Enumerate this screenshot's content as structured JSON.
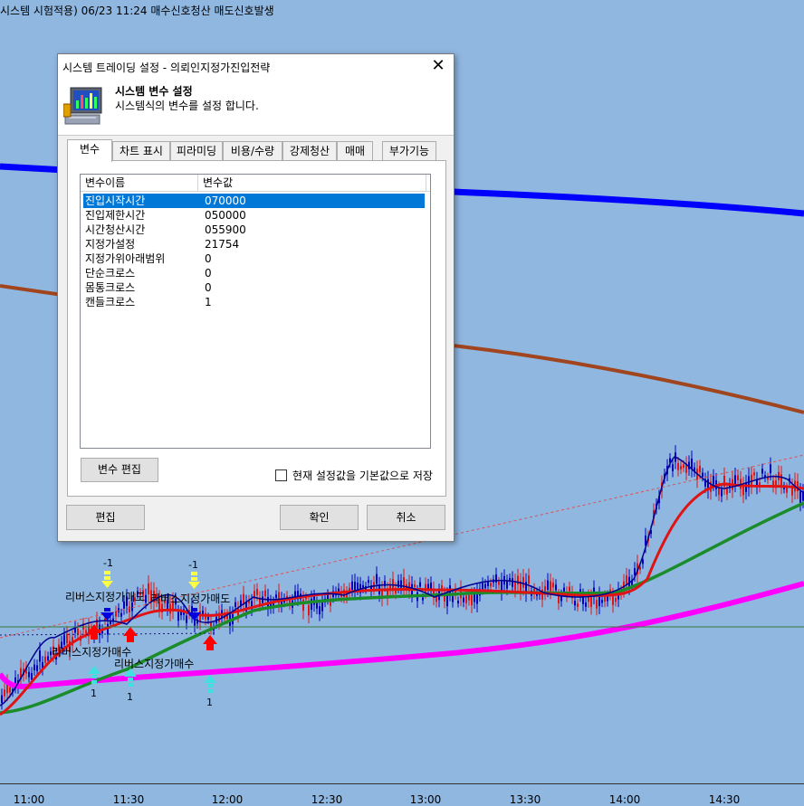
{
  "chart": {
    "title": "시스템 시험적용) 06/23 11:24 매수신호청산 매도신호발생",
    "time_labels": [
      "11:00",
      "11:30",
      "12:00",
      "12:30",
      "13:00",
      "13:30",
      "14:00",
      "14:30"
    ],
    "signals": [
      {
        "kind": "sell",
        "label": "리버스지정가매도",
        "qty": "-1"
      },
      {
        "kind": "sell",
        "label": "리버스지정가매도",
        "qty": "-1"
      },
      {
        "kind": "buy",
        "label": "리버스지정가매수",
        "qty": "1"
      },
      {
        "kind": "buy",
        "label": "리버스지정가매수",
        "qty": "1"
      },
      {
        "kind": "buy",
        "label": "리버스지정가매수",
        "qty": "1"
      }
    ],
    "colors": {
      "background": "#8fb7e0",
      "ma_blue": "#0000ff",
      "ma_brown": "#a0451e",
      "ma_magenta": "#ff00ff",
      "ma_green": "#1a8c2a",
      "ma_red": "#e01414",
      "ma_navy": "#000090"
    }
  },
  "dialog": {
    "title": "시스템 트레이딩 설정 - 의뢰인지정가진입전략",
    "header_title": "시스템 변수 설정",
    "header_sub": "시스템식의 변수를 설정 합니다.",
    "icon": "monitor-chart-icon",
    "tabs": [
      {
        "label": "변수",
        "active": true
      },
      {
        "label": "차트 표시",
        "active": false
      },
      {
        "label": "피라미딩",
        "active": false
      },
      {
        "label": "비용/수량",
        "active": false
      },
      {
        "label": "강제청산",
        "active": false
      },
      {
        "label": "매매",
        "active": false
      },
      {
        "label": "부가기능",
        "active": false
      }
    ],
    "list": {
      "columns": [
        "변수이름",
        "변수값"
      ],
      "rows": [
        {
          "name": "진입시작시간",
          "value": "070000",
          "selected": true
        },
        {
          "name": "진입제한시간",
          "value": "050000",
          "selected": false
        },
        {
          "name": "시간청산시간",
          "value": "055900",
          "selected": false
        },
        {
          "name": "지정가설정",
          "value": "21754",
          "selected": false
        },
        {
          "name": "지정가위아래범위",
          "value": "0",
          "selected": false
        },
        {
          "name": "단순크로스",
          "value": "0",
          "selected": false
        },
        {
          "name": "몸통크로스",
          "value": "0",
          "selected": false
        },
        {
          "name": "캔들크로스",
          "value": "1",
          "selected": false
        }
      ]
    },
    "edit_var_button": "변수 편집",
    "save_default_label": "현재 설정값을 기본값으로 저장",
    "save_default_checked": false,
    "edit_button": "편집",
    "ok_button": "확인",
    "cancel_button": "취소"
  }
}
